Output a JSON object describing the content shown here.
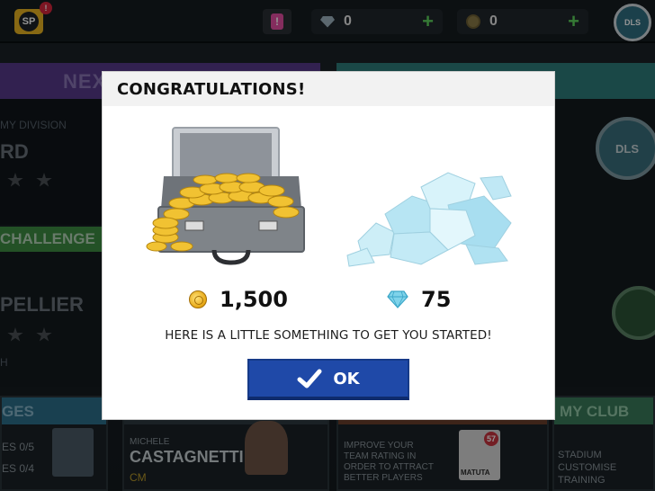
{
  "background": {
    "topbar": {
      "sp_badge": "SP",
      "sp_notification": "!",
      "alert_badge": "!",
      "gems": "0",
      "coins": "0",
      "club_logo": "DLS"
    },
    "left_panel_header": "NEX",
    "division_label": "MY DIVISION",
    "division_value": "RD",
    "challenge_header": "CHALLENGE",
    "challenge_opponent": "PELLIER",
    "challenge_small": "H",
    "right_logo_text": "DLS",
    "bottom": {
      "challenges_header": "GES",
      "challenges_rows": [
        "ES  0/5",
        "ES  0/4"
      ],
      "player_sub": "MICHELE",
      "player_name": "CASTAGNETTI",
      "player_pos": "CM",
      "scout_text": [
        "IMPROVE YOUR",
        "TEAM RATING IN",
        "ORDER TO ATTRACT",
        "BETTER PLAYERS"
      ],
      "scout_card_rating": "57",
      "scout_card_name": "MATUTA",
      "club_header": "MY CLUB",
      "club_items": [
        "STADIUM",
        "CUSTOMISE",
        "TRAINING"
      ]
    }
  },
  "modal": {
    "title": "CONGRATULATIONS!",
    "rewards": {
      "coins": "1,500",
      "gems": "75"
    },
    "message": "HERE IS A LITTLE SOMETHING TO GET YOU STARTED!",
    "ok_label": "OK"
  },
  "colors": {
    "ok_button": "#1f49a8",
    "coin": "#e6a714",
    "gem": "#7fd3ea"
  },
  "icons": [
    "coin-icon",
    "gem-icon",
    "check-icon",
    "briefcase-of-coins",
    "diamond-pile"
  ]
}
